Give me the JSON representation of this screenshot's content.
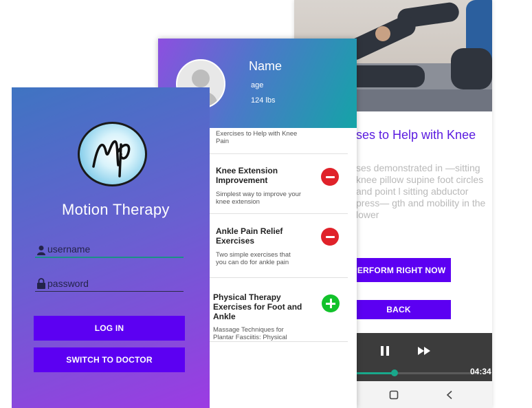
{
  "video_screen": {
    "exercise_title": "ses to Help with Knee",
    "exercise_description": "ses demonstrated in —sitting knee pillow supine foot circles and point l sitting abductor press— gth and mobility in the lower",
    "perform_button": "PERFORM RIGHT NOW",
    "back_button": "BACK",
    "player": {
      "time": "04:34",
      "progress": 0.32
    }
  },
  "profile_screen": {
    "name": "Name",
    "age": "age",
    "weight": "124 lbs",
    "items": [
      {
        "title": "",
        "subtitle": "Exercises to Help with Knee Pain",
        "action": "none"
      },
      {
        "title": "Knee Extension Improvement",
        "subtitle": "Simplest way to improve your knee extension",
        "action": "remove"
      },
      {
        "title": "Ankle Pain Relief Exercises",
        "subtitle": "Two simple exercises that you can do for ankle pain",
        "action": "remove"
      },
      {
        "title": "Physical Therapy Exercises for Foot and Ankle",
        "subtitle": "Massage Techniques for Plantar Fasciitis: Physical",
        "action": "add"
      }
    ]
  },
  "login_screen": {
    "app_title": "Motion Therapy",
    "username_placeholder": "username",
    "password_placeholder": "password",
    "login_button": "LOG IN",
    "switch_button": "SWITCH TO DOCTOR"
  },
  "colors": {
    "primary_button": "#5c00f2",
    "accent_title": "#5b1ce0",
    "remove": "#e0222a",
    "add": "#12c22b",
    "player_progress": "#19a88b"
  },
  "icons": [
    "user-icon",
    "lock-icon",
    "remove-icon",
    "add-icon",
    "rewind-icon",
    "pause-icon",
    "fast-forward-icon",
    "home-icon",
    "back-nav-icon",
    "avatar-icon"
  ]
}
